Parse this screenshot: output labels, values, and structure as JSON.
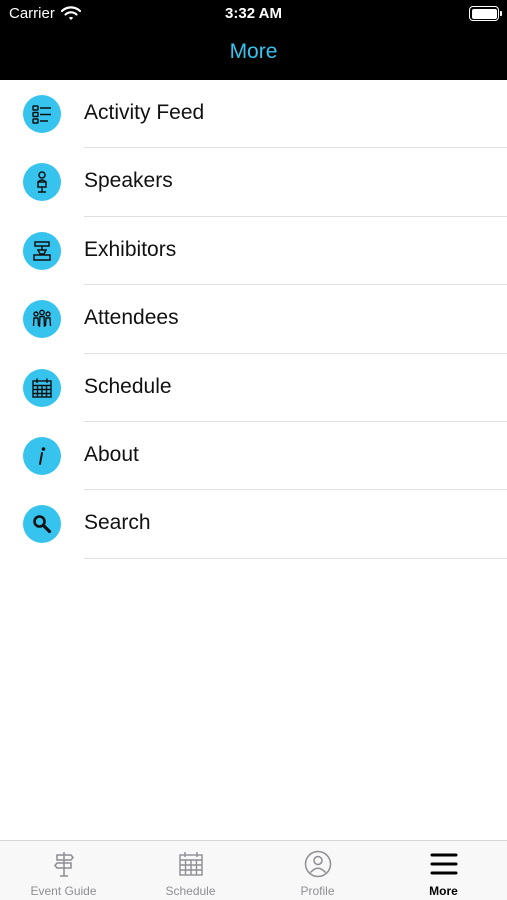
{
  "status_bar": {
    "carrier": "Carrier",
    "time": "3:32 AM",
    "wifi_icon": "wifi-icon",
    "battery_icon": "battery-icon"
  },
  "nav": {
    "title": "More"
  },
  "colors": {
    "accent": "#36c3ee",
    "nav_background": "#000000",
    "tab_inactive": "#8e8e93",
    "tab_active": "#000000"
  },
  "menu": {
    "items": [
      {
        "label": "Activity Feed",
        "icon": "activity-feed-icon"
      },
      {
        "label": "Speakers",
        "icon": "speaker-podium-icon"
      },
      {
        "label": "Exhibitors",
        "icon": "exhibitor-booth-icon"
      },
      {
        "label": "Attendees",
        "icon": "attendees-group-icon"
      },
      {
        "label": "Schedule",
        "icon": "calendar-icon"
      },
      {
        "label": "About",
        "icon": "info-icon"
      },
      {
        "label": "Search",
        "icon": "magnifier-icon"
      }
    ]
  },
  "tabbar": {
    "tabs": [
      {
        "label": "Event Guide",
        "icon": "signpost-icon",
        "active": false
      },
      {
        "label": "Schedule",
        "icon": "calendar-icon",
        "active": false
      },
      {
        "label": "Profile",
        "icon": "profile-icon",
        "active": false
      },
      {
        "label": "More",
        "icon": "hamburger-menu-icon",
        "active": true
      }
    ]
  }
}
